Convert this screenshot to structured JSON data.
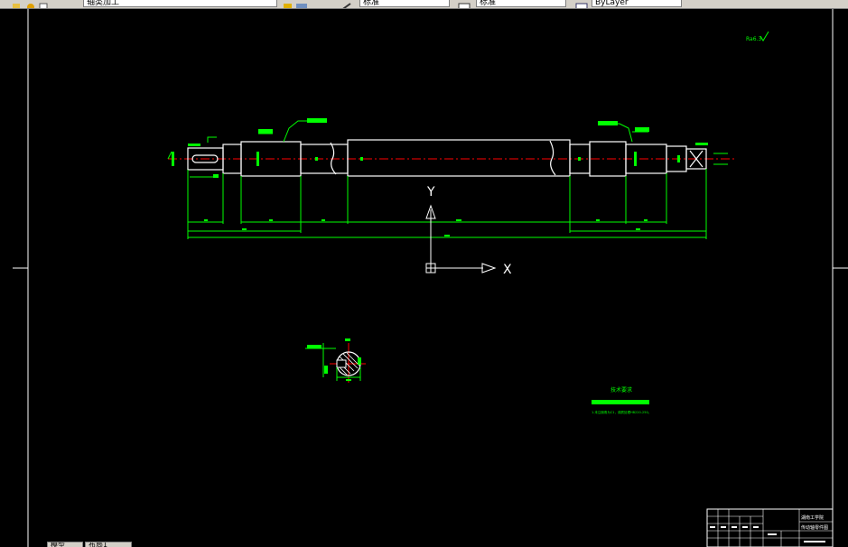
{
  "app": {
    "toolbar": {
      "layer_combo_text": "轴类加工",
      "linetype_combo_text": "ByLayer",
      "style_combo_text": "标准",
      "dimstyle_combo_text": "标准",
      "color_combo_text": "ByLayer"
    },
    "tabs": [
      "模型",
      "布局1"
    ]
  },
  "drawing": {
    "roughness_note": "Ra6.3",
    "ucs": {
      "x_label": "X",
      "y_label": "Y"
    },
    "tech_req_title": "技术要求",
    "tech_req_line": "1.未注倒角为C1，调质处理HB220-250。",
    "title_block": {
      "school": "湖南工学院",
      "drawing_name": "传动轴零件图"
    }
  },
  "colors": {
    "background": "#000000",
    "outline": "#ffffff",
    "dimension": "#00ff00",
    "centerline": "#ff0000",
    "toolbar": "#d4d0c8"
  }
}
